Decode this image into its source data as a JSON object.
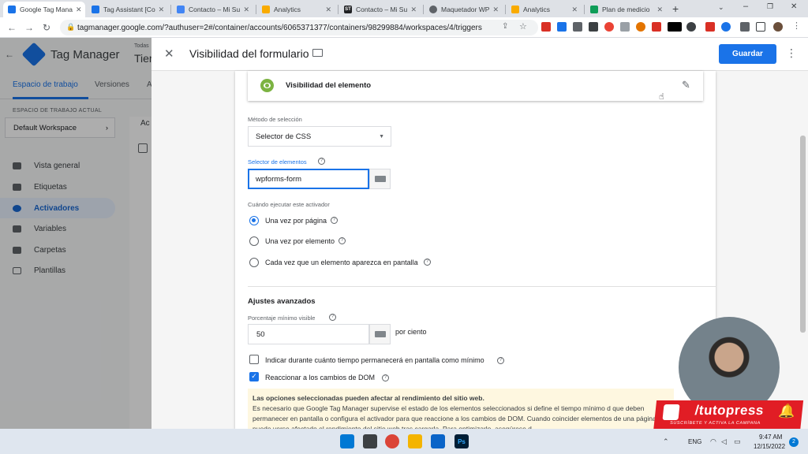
{
  "browser": {
    "tabs": [
      {
        "label": "Google Tag Mana",
        "color": "#1a73e8",
        "active": true
      },
      {
        "label": "Tag Assistant [Co",
        "color": "#1a73e8"
      },
      {
        "label": "Contacto – Mi Su",
        "color": "#4285f4"
      },
      {
        "label": "Analytics",
        "color": "#f9ab00"
      },
      {
        "label": "Contacto – Mi Su",
        "color": "#202124",
        "glyph": "ST"
      },
      {
        "label": "Maquetador WP",
        "color": "#5f6368"
      },
      {
        "label": "Analytics",
        "color": "#f9ab00"
      },
      {
        "label": "Plan de medicio",
        "color": "#0f9d58"
      }
    ],
    "url": "tagmanager.google.com/?authuser=2#/container/accounts/6065371377/containers/98299884/workspaces/4/triggers"
  },
  "gtm": {
    "app_name": "Tag Manager",
    "header_partial_top": "Todas",
    "header_partial_bottom": "Tier",
    "tabs": [
      "Espacio de trabajo",
      "Versiones",
      "A"
    ],
    "workspace_label": "ESPACIO DE TRABAJO ACTUAL",
    "workspace_name": "Default Workspace",
    "nav": [
      "Vista general",
      "Etiquetas",
      "Activadores",
      "Variables",
      "Carpetas",
      "Plantillas"
    ],
    "behind_text": "Ac"
  },
  "panel": {
    "title": "Visibilidad del formulario",
    "save_label": "Guardar",
    "trigger_type": "Visibilidad del elemento",
    "selection_method_label": "Método de selección",
    "selection_method_value": "Selector de CSS",
    "element_selector_label": "Selector de elementos",
    "element_selector_value": "wpforms-form",
    "when_label": "Cuándo ejecutar este activador",
    "when_options": [
      "Una vez por página",
      "Una vez por elemento",
      "Cada vez que un elemento aparezca en pantalla"
    ],
    "advanced_title": "Ajustes avanzados",
    "min_visible_label": "Porcentaje mínimo visible",
    "min_visible_value": "50",
    "min_visible_suffix": "por ciento",
    "check_time_label": "Indicar durante cuánto tiempo permanecerá en pantalla como mínimo",
    "check_dom_label": "Reaccionar a los cambios de DOM",
    "warning_title": "Las opciones seleccionadas pueden afectar al rendimiento del sitio web.",
    "warning_body": "Es necesario que Google Tag Manager supervise el estado de los elementos seleccionados si define el tiempo mínimo d que deben permanecer en pantalla o configura el activador para que reaccione a los cambios de DOM. Cuando coincider elementos de una página, puede verse afectado el rendimiento del sitio web tras cargarla. Para optimizarlo, asegúrese d"
  },
  "overlay": {
    "brand": "/tutopress",
    "slogan": "SUSCRÍBETE Y ACTIVA LA CAMPANA"
  },
  "taskbar": {
    "lang": "ENG",
    "time": "9:47 AM",
    "date": "12/15/2022",
    "notif": "2"
  }
}
